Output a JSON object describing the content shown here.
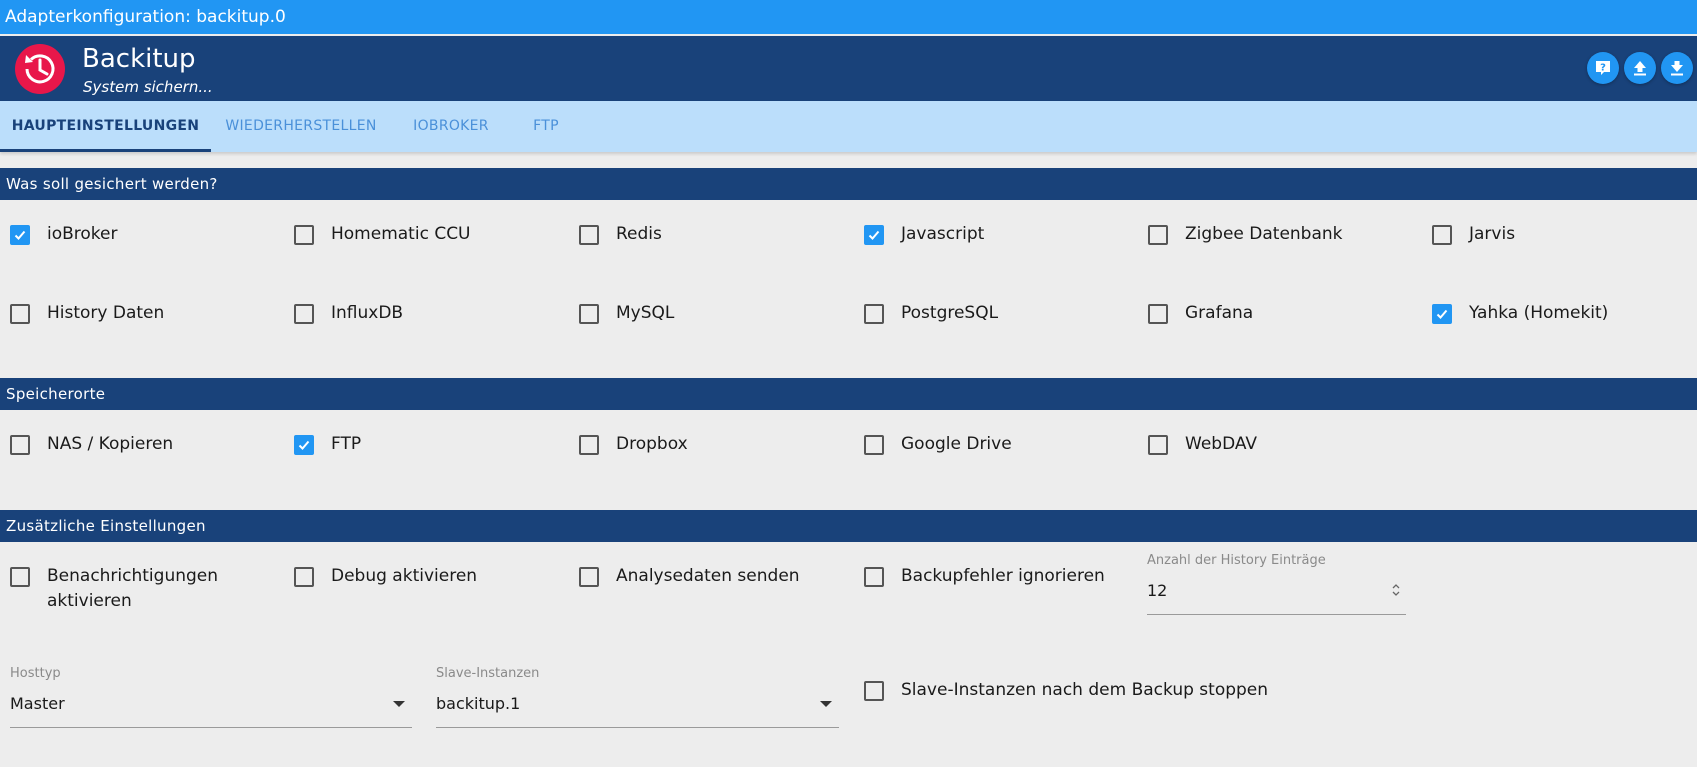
{
  "window": {
    "title": "Adapterkonfiguration: backitup.0"
  },
  "header": {
    "app_name": "Backitup",
    "subtitle": "System sichern...",
    "buttons": [
      "help-icon",
      "upload-icon",
      "download-icon"
    ]
  },
  "tabs": [
    {
      "label": "HAUPTEINSTELLUNGEN",
      "active": true
    },
    {
      "label": "WIEDERHERSTELLEN",
      "active": false
    },
    {
      "label": "IOBROKER",
      "active": false
    },
    {
      "label": "FTP",
      "active": false
    }
  ],
  "sections": {
    "backup": {
      "title": "Was soll gesichert werden?",
      "items": [
        {
          "label": "ioBroker",
          "checked": true
        },
        {
          "label": "Homematic CCU",
          "checked": false
        },
        {
          "label": "Redis",
          "checked": false
        },
        {
          "label": "Javascript",
          "checked": true
        },
        {
          "label": "Zigbee Datenbank",
          "checked": false
        },
        {
          "label": "Jarvis",
          "checked": false
        },
        {
          "label": "History Daten",
          "checked": false
        },
        {
          "label": "InfluxDB",
          "checked": false
        },
        {
          "label": "MySQL",
          "checked": false
        },
        {
          "label": "PostgreSQL",
          "checked": false
        },
        {
          "label": "Grafana",
          "checked": false
        },
        {
          "label": "Yahka (Homekit)",
          "checked": true
        }
      ]
    },
    "storage": {
      "title": "Speicherorte",
      "items": [
        {
          "label": "NAS / Kopieren",
          "checked": false
        },
        {
          "label": "FTP",
          "checked": true
        },
        {
          "label": "Dropbox",
          "checked": false
        },
        {
          "label": "Google Drive",
          "checked": false
        },
        {
          "label": "WebDAV",
          "checked": false
        }
      ]
    },
    "extra": {
      "title": "Zusätzliche Einstellungen",
      "notifications": {
        "label_line1": "Benachrichtigungen",
        "label_line2": "aktivieren",
        "checked": false
      },
      "debug": {
        "label": "Debug aktivieren",
        "checked": false
      },
      "analytics": {
        "label": "Analysedaten senden",
        "checked": false
      },
      "ignore_errors": {
        "label": "Backupfehler ignorieren",
        "checked": false
      },
      "history_count": {
        "label": "Anzahl der History Einträge",
        "value": "12"
      },
      "host_type": {
        "label": "Hosttyp",
        "value": "Master"
      },
      "slave_instances": {
        "label": "Slave-Instanzen",
        "value": "backitup.1"
      },
      "stop_slaves": {
        "label": "Slave-Instanzen nach dem Backup stoppen",
        "checked": false
      }
    }
  },
  "colors": {
    "title_bar": "#2196f3",
    "header": "#19427a",
    "tab_bar": "#bbdefb",
    "checked": "#2196f3",
    "logo": "#e8174a"
  }
}
